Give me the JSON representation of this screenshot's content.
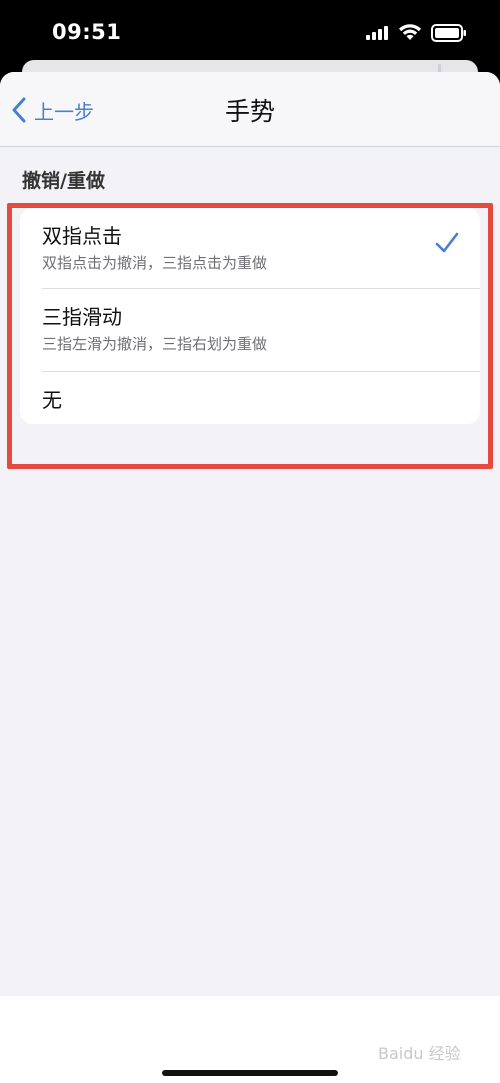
{
  "status_bar": {
    "time": "09:51"
  },
  "nav": {
    "back_label": "上一步",
    "title": "手势"
  },
  "section": {
    "header": "撤销/重做"
  },
  "options": [
    {
      "title": "双指点击",
      "subtitle": "双指点击为撤消，三指点击为重做",
      "selected": true
    },
    {
      "title": "三指滑动",
      "subtitle": "三指左滑为撤消，三指右划为重做",
      "selected": false
    },
    {
      "title": "无",
      "subtitle": "",
      "selected": false
    }
  ],
  "colors": {
    "accent": "#4a7fd0",
    "highlight": "#e24a42",
    "background": "#f2f2f7"
  },
  "watermark": "Baidu 经验"
}
